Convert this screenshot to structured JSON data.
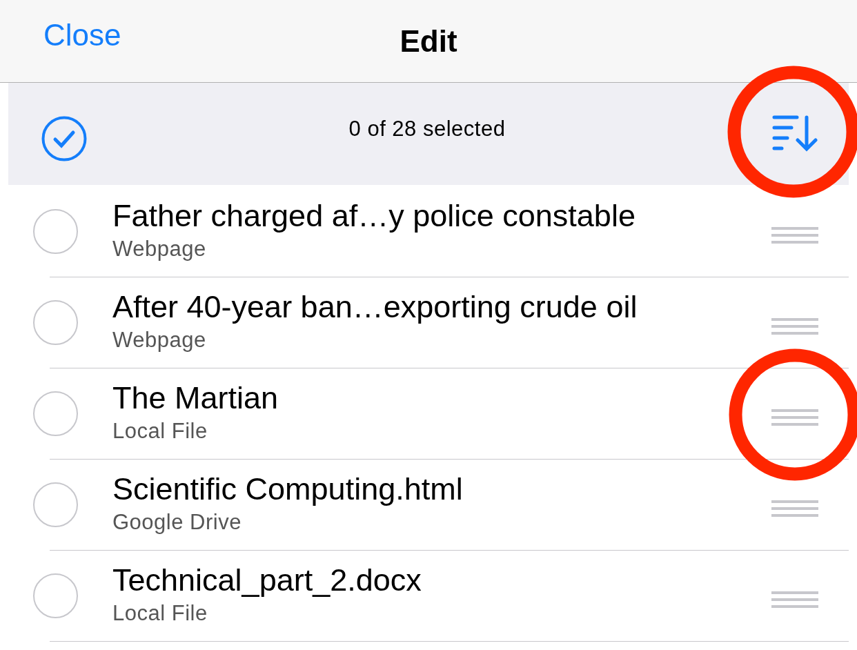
{
  "nav": {
    "close": "Close",
    "title": "Edit"
  },
  "toolbar": {
    "select_all_checked": false,
    "count": "0 of 28 selected",
    "sort_highlighted": true
  },
  "items": [
    {
      "title": "Father charged af…y police constable",
      "source": "Webpage",
      "selected": false,
      "handle_highlighted": false
    },
    {
      "title": "After 40-year ban…exporting crude oil",
      "source": "Webpage",
      "selected": false,
      "handle_highlighted": false
    },
    {
      "title": "The Martian",
      "source": "Local File",
      "selected": false,
      "handle_highlighted": true
    },
    {
      "title": "Scientific Computing.html",
      "source": "Google Drive",
      "selected": false,
      "handle_highlighted": false
    },
    {
      "title": "Technical_part_2.docx",
      "source": "Local File",
      "selected": false,
      "handle_highlighted": false
    }
  ]
}
